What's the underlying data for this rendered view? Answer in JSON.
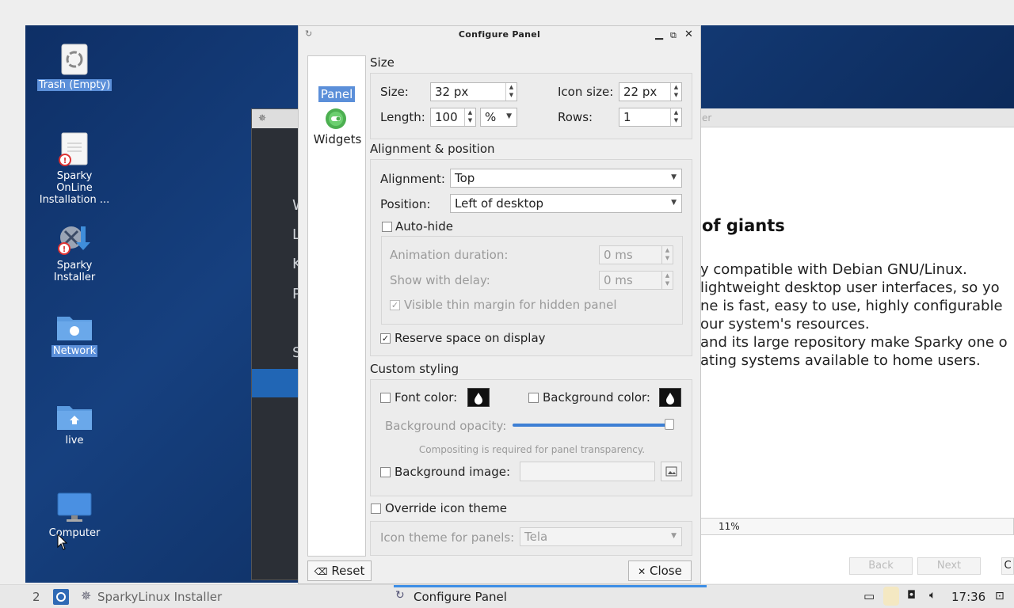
{
  "desktop_icons": [
    {
      "label": "Trash (Empty)",
      "icon": "trash-icon",
      "selected": true
    },
    {
      "label": "Sparky OnLine Installation ...",
      "icon": "installer-doc-icon",
      "selected": false
    },
    {
      "label": "Sparky Installer",
      "icon": "sparky-installer-icon",
      "selected": false
    },
    {
      "label": "Network",
      "icon": "network-folder-icon",
      "selected": true
    },
    {
      "label": "live",
      "icon": "home-folder-icon",
      "selected": false
    },
    {
      "label": "Computer",
      "icon": "computer-icon",
      "selected": false
    }
  ],
  "installer_ghost_letters": [
    "W",
    "L",
    "K",
    "P",
    "S"
  ],
  "slideshow": {
    "title_bar_fragment": "er",
    "title": "of giants",
    "lines": [
      "y compatible with Debian GNU/Linux.",
      " lightweight desktop user interfaces, so yo",
      "ne is fast, easy to use, highly configurable",
      "our system's resources.",
      "and its large repository make Sparky one o",
      "ating systems available to home users."
    ],
    "progress_label": "11%",
    "progress_value": 0.11,
    "back_label": "Back",
    "next_label": "Next",
    "cut_label": "C"
  },
  "dialog": {
    "title": "Configure Panel",
    "sidebar": {
      "panel_label": "Panel",
      "widgets_label": "Widgets"
    },
    "size_section": {
      "heading": "Size",
      "size_label": "Size:",
      "size_value": "32 px",
      "icon_size_label": "Icon size:",
      "icon_size_value": "22 px",
      "length_label": "Length:",
      "length_value": "100",
      "length_unit": "%",
      "rows_label": "Rows:",
      "rows_value": "1"
    },
    "alignment_section": {
      "heading": "Alignment & position",
      "alignment_label": "Alignment:",
      "alignment_value": "Top",
      "position_label": "Position:",
      "position_value": "Left of desktop",
      "autohide_label": "Auto-hide",
      "autohide_checked": false,
      "animation_label": "Animation duration:",
      "animation_value": "0 ms",
      "delay_label": "Show with delay:",
      "delay_value": "0 ms",
      "thin_margin_label": "Visible thin margin for hidden panel",
      "thin_margin_checked": true,
      "reserve_label": "Reserve space on display",
      "reserve_checked": true
    },
    "styling_section": {
      "heading": "Custom styling",
      "font_color_label": "Font color:",
      "bg_color_label": "Background color:",
      "opacity_label": "Background opacity:",
      "opacity_value": 1.0,
      "compositing_note": "Compositing is required for panel transparency.",
      "bg_image_label": "Background image:",
      "bg_image_value": ""
    },
    "icon_theme": {
      "override_label": "Override icon theme",
      "theme_label": "Icon theme for panels:",
      "theme_value": "Tela"
    },
    "reset_label": "Reset",
    "close_label": "Close"
  },
  "taskbar": {
    "workspace": "2",
    "tasks": [
      "SparkyLinux Installer",
      "Configure Panel"
    ],
    "clock": "17:36"
  },
  "colors": {
    "selection": "#5b8fd9",
    "desktop": "#0e2f66",
    "active_task_underline": "#3d8ee6"
  }
}
